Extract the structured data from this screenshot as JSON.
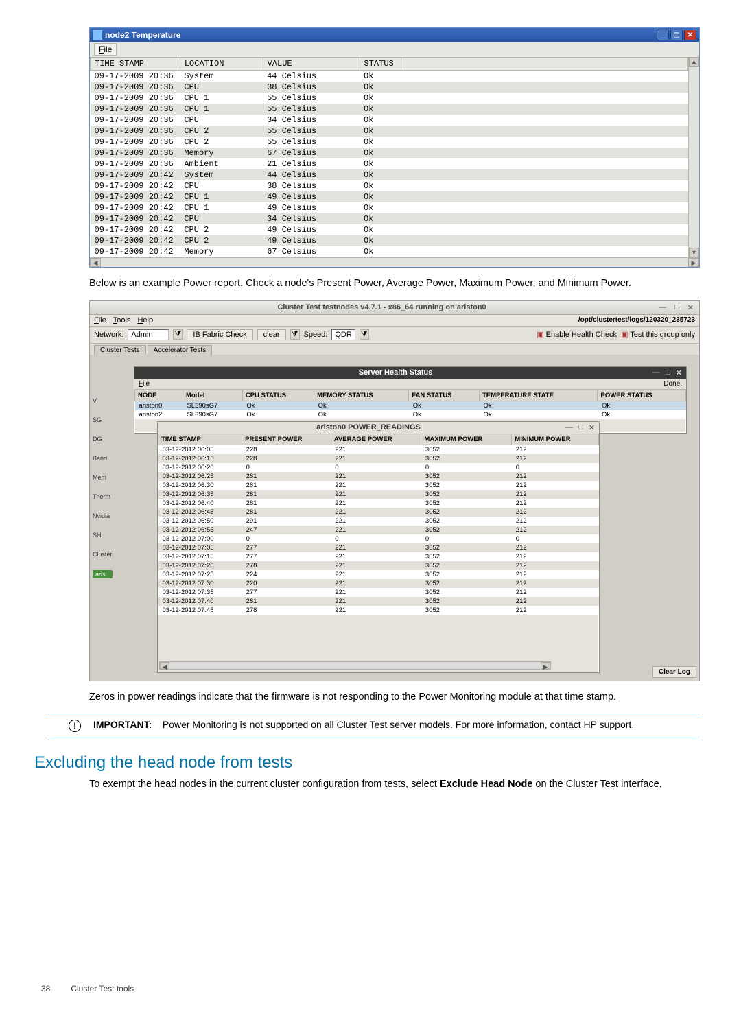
{
  "temp_window": {
    "title": "node2 Temperature",
    "menu_file": "File",
    "columns": [
      "TIME STAMP",
      "LOCATION",
      "VALUE",
      "STATUS"
    ],
    "rows": [
      [
        "09-17-2009 20:36",
        "System",
        "44 Celsius",
        "Ok"
      ],
      [
        "09-17-2009 20:36",
        "CPU",
        "38 Celsius",
        "Ok"
      ],
      [
        "09-17-2009 20:36",
        "CPU 1",
        "55 Celsius",
        "Ok"
      ],
      [
        "09-17-2009 20:36",
        "CPU 1",
        "55 Celsius",
        "Ok"
      ],
      [
        "09-17-2009 20:36",
        "CPU",
        "34 Celsius",
        "Ok"
      ],
      [
        "09-17-2009 20:36",
        "CPU 2",
        "55 Celsius",
        "Ok"
      ],
      [
        "09-17-2009 20:36",
        "CPU 2",
        "55 Celsius",
        "Ok"
      ],
      [
        "09-17-2009 20:36",
        "Memory",
        "67 Celsius",
        "Ok"
      ],
      [
        "09-17-2009 20:36",
        "Ambient",
        "21 Celsius",
        "Ok"
      ],
      [
        "09-17-2009 20:42",
        "System",
        "44 Celsius",
        "Ok"
      ],
      [
        "09-17-2009 20:42",
        "CPU",
        "38 Celsius",
        "Ok"
      ],
      [
        "09-17-2009 20:42",
        "CPU 1",
        "49 Celsius",
        "Ok"
      ],
      [
        "09-17-2009 20:42",
        "CPU 1",
        "49 Celsius",
        "Ok"
      ],
      [
        "09-17-2009 20:42",
        "CPU",
        "34 Celsius",
        "Ok"
      ],
      [
        "09-17-2009 20:42",
        "CPU 2",
        "49 Celsius",
        "Ok"
      ],
      [
        "09-17-2009 20:42",
        "CPU 2",
        "49 Celsius",
        "Ok"
      ],
      [
        "09-17-2009 20:42",
        "Memory",
        "67 Celsius",
        "Ok"
      ]
    ]
  },
  "para1": "Below is an example Power report. Check a node's Present Power, Average Power, Maximum Power, and Minimum Power.",
  "ct_window": {
    "main_title": "Cluster Test testnodes v4.7.1 - x86_64 running on ariston0",
    "menu": {
      "file": "File",
      "tools": "Tools",
      "help": "Help"
    },
    "path": "/opt/clustertest/logs/120320_235723",
    "toolbar": {
      "network_label": "Network:",
      "network_value": "Admin",
      "ib_fabric": "IB Fabric Check",
      "clear": "clear",
      "speed_label": "Speed:",
      "speed_value": "QDR",
      "chk1": "Enable Health Check",
      "chk2": "Test this group only"
    },
    "tabs": [
      "Cluster Tests",
      "Accelerator Tests"
    ],
    "left_labels": [
      "V",
      "SG",
      "DG",
      "Band",
      "Mem",
      "Therm",
      "Nvidia",
      "SH",
      "Cluster",
      "aris"
    ],
    "health_window": {
      "title": "Server Health Status",
      "menu_file": "File",
      "done": "Done.",
      "columns": [
        "NODE",
        "Model",
        "CPU STATUS",
        "MEMORY STATUS",
        "FAN STATUS",
        "TEMPERATURE STATE",
        "POWER STATUS"
      ],
      "rows": [
        [
          "ariston0",
          "SL390sG7",
          "Ok",
          "Ok",
          "Ok",
          "Ok",
          "Ok"
        ],
        [
          "ariston2",
          "SL390sG7",
          "Ok",
          "Ok",
          "Ok",
          "Ok",
          "Ok"
        ]
      ]
    },
    "power_window": {
      "title": "ariston0 POWER_READINGS",
      "columns": [
        "TIME STAMP",
        "PRESENT POWER",
        "AVERAGE POWER",
        "MAXIMUM POWER",
        "MINIMUM POWER"
      ],
      "rows": [
        [
          "03-12-2012 06:05",
          "228",
          "221",
          "3052",
          "212"
        ],
        [
          "03-12-2012 06:15",
          "228",
          "221",
          "3052",
          "212"
        ],
        [
          "03-12-2012 06:20",
          "0",
          "0",
          "0",
          "0"
        ],
        [
          "03-12-2012 06:25",
          "281",
          "221",
          "3052",
          "212"
        ],
        [
          "03-12-2012 06:30",
          "281",
          "221",
          "3052",
          "212"
        ],
        [
          "03-12-2012 06:35",
          "281",
          "221",
          "3052",
          "212"
        ],
        [
          "03-12-2012 06:40",
          "281",
          "221",
          "3052",
          "212"
        ],
        [
          "03-12-2012 06:45",
          "281",
          "221",
          "3052",
          "212"
        ],
        [
          "03-12-2012 06:50",
          "291",
          "221",
          "3052",
          "212"
        ],
        [
          "03-12-2012 06:55",
          "247",
          "221",
          "3052",
          "212"
        ],
        [
          "03-12-2012 07:00",
          "0",
          "0",
          "0",
          "0"
        ],
        [
          "03-12-2012 07:05",
          "277",
          "221",
          "3052",
          "212"
        ],
        [
          "03-12-2012 07:15",
          "277",
          "221",
          "3052",
          "212"
        ],
        [
          "03-12-2012 07:20",
          "278",
          "221",
          "3052",
          "212"
        ],
        [
          "03-12-2012 07:25",
          "224",
          "221",
          "3052",
          "212"
        ],
        [
          "03-12-2012 07:30",
          "220",
          "221",
          "3052",
          "212"
        ],
        [
          "03-12-2012 07:35",
          "277",
          "221",
          "3052",
          "212"
        ],
        [
          "03-12-2012 07:40",
          "281",
          "221",
          "3052",
          "212"
        ],
        [
          "03-12-2012 07:45",
          "278",
          "221",
          "3052",
          "212"
        ]
      ],
      "clear_log": "Clear Log"
    }
  },
  "para2": "Zeros in power readings indicate that the firmware is not responding to the Power Monitoring module at that time stamp.",
  "important": {
    "label": "IMPORTANT:",
    "text": "Power Monitoring is not supported on all Cluster Test server models. For more information, contact HP support."
  },
  "heading": "Excluding the head node from tests",
  "exclude_para_a": "To exempt the head nodes in the current cluster configuration from tests, select ",
  "exclude_bold": "Exclude Head Node",
  "exclude_para_b": " on the Cluster Test interface.",
  "footer": {
    "page": "38",
    "section": "Cluster Test tools"
  }
}
